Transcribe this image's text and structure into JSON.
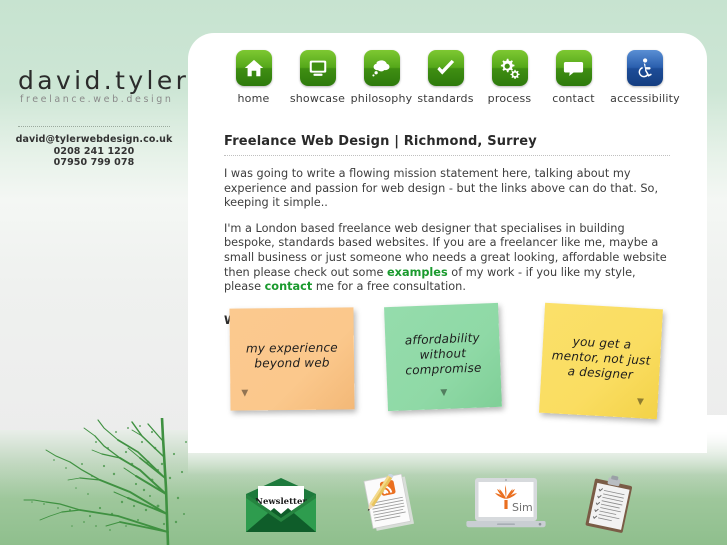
{
  "site": {
    "logo_main": "david.tyler",
    "logo_sub": "freelance.web.design",
    "email": "david@tylerwebdesign.co.uk",
    "phone1": "0208 241 1220",
    "phone2": "07950 799 078"
  },
  "nav": {
    "items": [
      {
        "label": "home",
        "icon": "house-icon",
        "color": "#46930f"
      },
      {
        "label": "showcase",
        "icon": "monitor-icon",
        "color": "#46930f"
      },
      {
        "label": "philosophy",
        "icon": "thought-bubble-icon",
        "color": "#46930f"
      },
      {
        "label": "standards",
        "icon": "checkmark-icon",
        "color": "#46930f"
      },
      {
        "label": "process",
        "icon": "gears-icon",
        "color": "#46930f"
      },
      {
        "label": "contact",
        "icon": "speech-bubble-icon",
        "color": "#46930f"
      },
      {
        "label": "accessibility",
        "icon": "wheelchair-icon",
        "color": "#21559e"
      }
    ]
  },
  "main": {
    "title": "Freelance Web Design | Richmond, Surrey",
    "paragraph1": "I was going to write a flowing mission statement here, talking about my experience and passion for web design - but the links above can do that. So, keeping it simple..",
    "paragraph2_a": "I'm a London based freelance web designer that specialises in building bespoke, standards based websites. If you are a freelancer like me, maybe a small business or just someone who needs a great looking, affordable website then please check out some ",
    "link_examples": "examples",
    "paragraph2_b": " of my work - if you like my style, please ",
    "link_contact": "contact",
    "paragraph2_c": " me for a free consultation.",
    "why_me": "Why me?"
  },
  "notes": [
    {
      "text": "my experience beyond web",
      "color": "#fbc88c",
      "name": "note-experience"
    },
    {
      "text": "affordability without compromise",
      "color": "#8fd9a6",
      "name": "note-affordability"
    },
    {
      "text": "you get a mentor, not just a designer",
      "color": "#fadd61",
      "name": "note-mentor"
    }
  ],
  "footer": {
    "icons": [
      {
        "name": "newsletter-envelope-icon",
        "label": "Newsletter"
      },
      {
        "name": "blog-rss-document-icon",
        "label": ""
      },
      {
        "name": "laptop-sim-icon",
        "label": "Sim"
      },
      {
        "name": "clipboard-checklist-icon",
        "label": ""
      }
    ]
  },
  "colors": {
    "accent_green": "#1a9a2e",
    "nav_green": "#46930f",
    "nav_blue": "#21559e",
    "bg_mint": "#cde6d5",
    "bg_grass": "#8fbf8d"
  }
}
